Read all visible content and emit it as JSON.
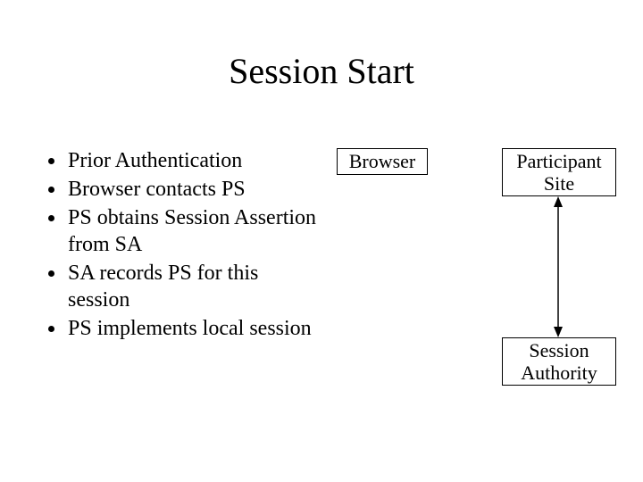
{
  "title": "Session Start",
  "bullets": [
    "Prior Authentication",
    "Browser contacts PS",
    "PS obtains Session Assertion from SA",
    "SA records PS for this session",
    "PS implements local session"
  ],
  "diagram": {
    "browser_label": "Browser",
    "participant_label": "Participant Site",
    "session_authority_label": "Session Authority"
  }
}
